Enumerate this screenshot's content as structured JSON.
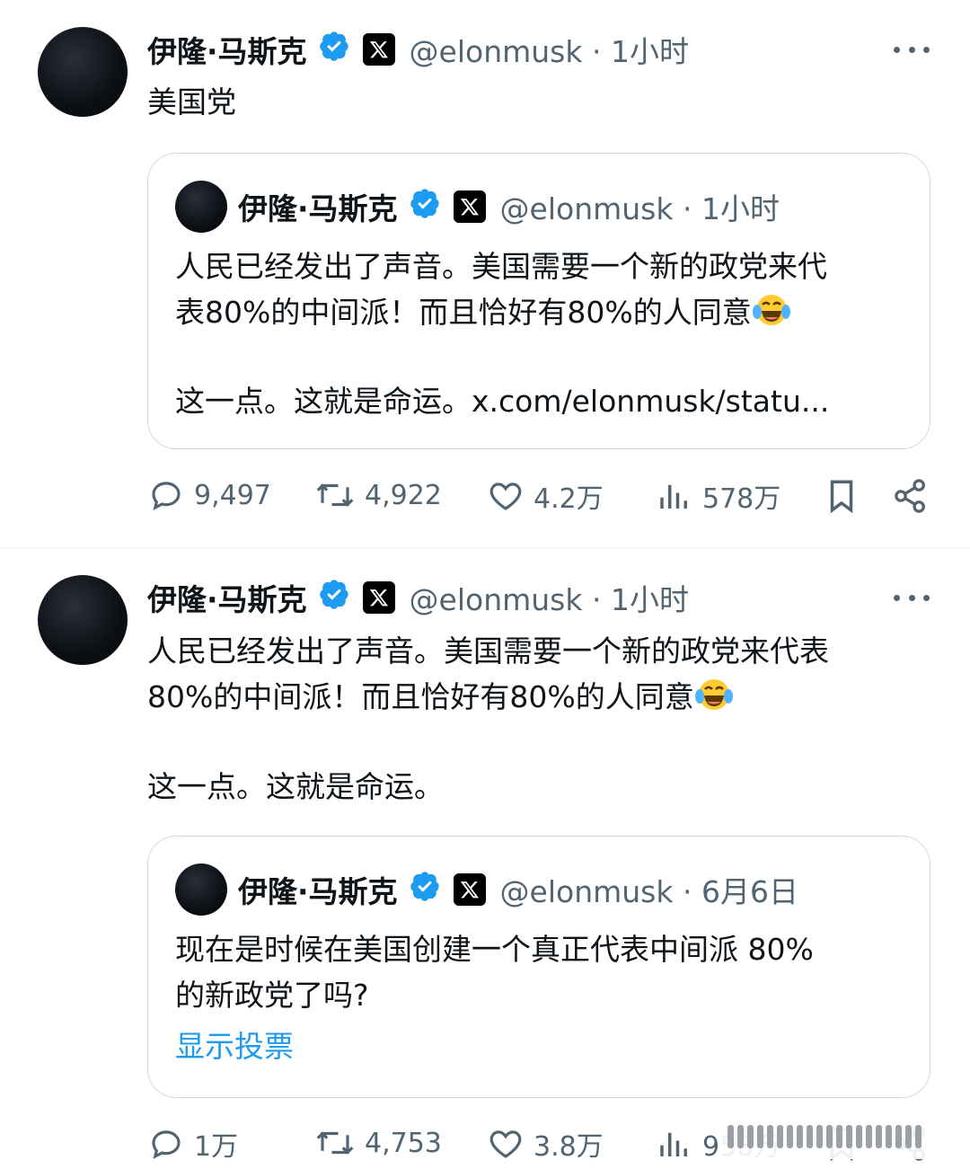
{
  "tweet1": {
    "name": "伊隆·马斯克",
    "handle": "@elonmusk · 1小时",
    "text": "美国党",
    "quote": {
      "name": "伊隆·马斯克",
      "handle": "@elonmusk · 1小时",
      "line1": "人民已经发出了声音。美国需要一个新的政党来代",
      "line2": "表80%的中间派！而且恰好有80%的人同意",
      "line3": "这一点。这就是命运。x.com/elonmusk/statu..."
    },
    "actions": {
      "replies": "9,497",
      "reposts": "4,922",
      "likes": "4.2万",
      "views": "578万"
    }
  },
  "tweet2": {
    "name": "伊隆·马斯克",
    "handle": "@elonmusk · 1小时",
    "line1": "人民已经发出了声音。美国需要一个新的政党来代表",
    "line2": "80%的中间派！而且恰好有80%的人同意",
    "line3": "这一点。这就是命运。",
    "quote": {
      "name": "伊隆·马斯克",
      "handle": "@elonmusk · 6月6日",
      "line1": "现在是时候在美国创建一个真正代表中间派 80%",
      "line2": "的新政党了吗?",
      "poll_link": "显示投票"
    },
    "actions": {
      "replies": "1万",
      "reposts": "4,753",
      "likes": "3.8万",
      "views": "958万"
    }
  },
  "icons": {
    "verified": "verified-badge-icon",
    "x_logo": "x-logo-icon",
    "emoji": "tears-of-joy-emoji-icon"
  },
  "colors": {
    "accent": "#1d9bf0",
    "muted": "#536471",
    "border": "#cfd9de"
  }
}
